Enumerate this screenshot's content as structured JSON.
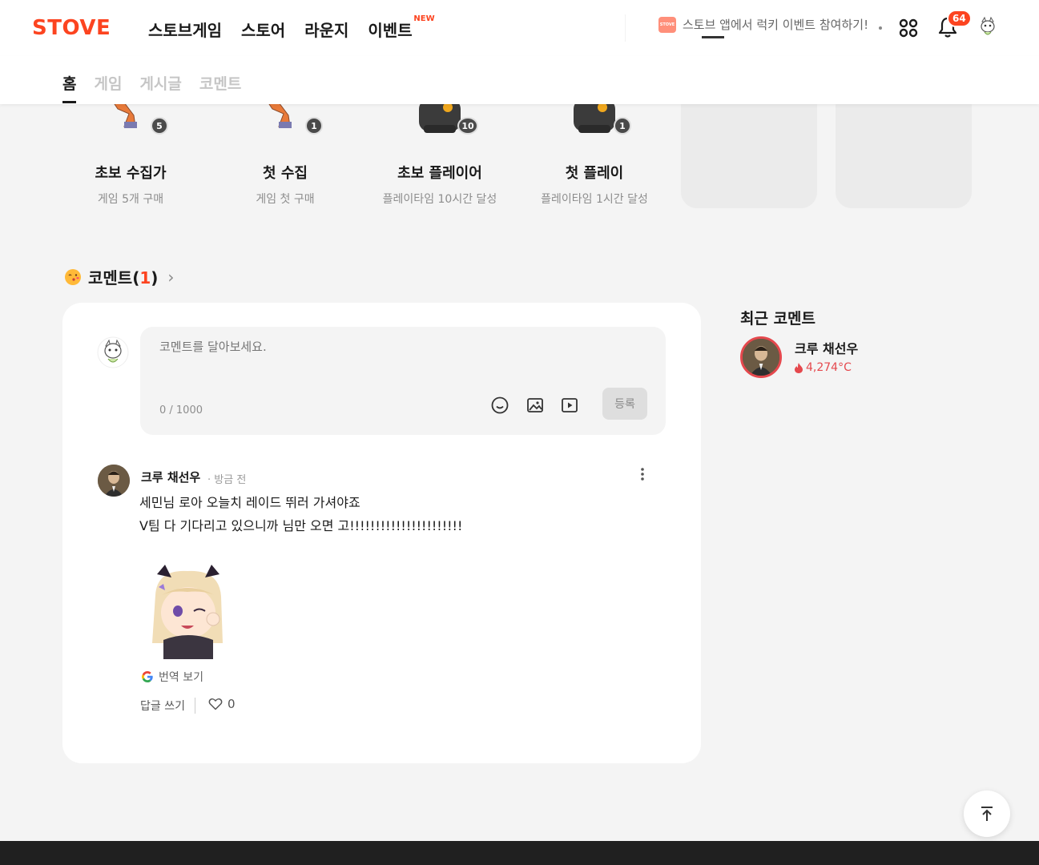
{
  "header": {
    "logo": "STOVE",
    "nav": [
      "스토브게임",
      "스토어",
      "라운지",
      "이벤트"
    ],
    "nav_new_badge": "NEW",
    "promo_icon_text": "STOVE",
    "promo_text": "스토브 앱에서 럭키 이벤트 참여하기!",
    "notification_count": "64",
    "accent_color": "#fc4420"
  },
  "tabs": [
    "홈",
    "게임",
    "게시글",
    "코멘트"
  ],
  "active_tab": "홈",
  "badges": [
    {
      "name": "초보 수집가",
      "desc": "게임 5개 구매",
      "count": "5",
      "icon": "boot-icon"
    },
    {
      "name": "첫 수집",
      "desc": "게임 첫 구매",
      "count": "1",
      "icon": "boot-icon"
    },
    {
      "name": "초보 플레이어",
      "desc": "플레이타임 10시간 달성",
      "count": "10",
      "icon": "gamepad-icon"
    },
    {
      "name": "첫 플레이",
      "desc": "플레이타임 1시간 달성",
      "count": "1",
      "icon": "gamepad-icon"
    }
  ],
  "comments_section": {
    "title": "코멘트",
    "count": "1",
    "open_paren": "(",
    "close_paren": ")",
    "chevron": "›",
    "editor_placeholder": "코멘트를 달아보세요.",
    "char_count": "0 / 1000",
    "submit_label": "등록"
  },
  "comment": {
    "author": "크루 채선우",
    "time": "방금 전",
    "line1": "세민님 로아 오늘치 레이드 뛰러 가셔야죠",
    "line2": "V팀 다 기다리고 있으니까 님만 오면 고!!!!!!!!!!!!!!!!!!!!!!",
    "translate_label": "번역 보기",
    "reply_label": "답글 쓰기",
    "like_count": "0"
  },
  "recent": {
    "title": "최근 코멘트",
    "name": "크루 채선우",
    "temperature": "4,274°C"
  }
}
